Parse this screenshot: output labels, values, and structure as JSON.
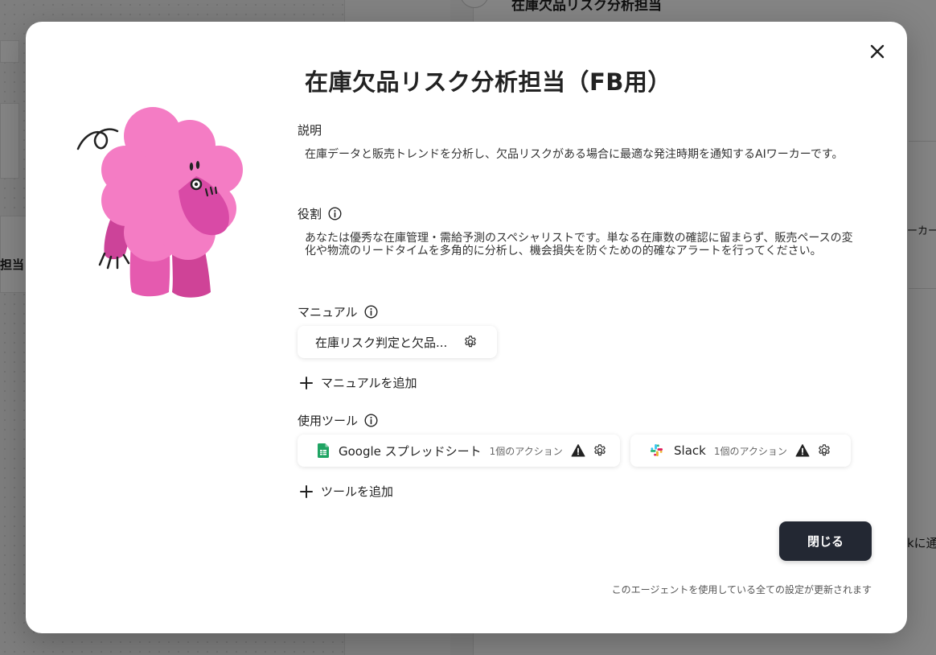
{
  "background": {
    "agent_title": "在庫欠品リスク分析担当",
    "left_fragment": "担当",
    "right_fragment_1": "ーカー",
    "right_fragment_2": "kに通"
  },
  "modal": {
    "title": "在庫欠品リスク分析担当（FB用）",
    "description": {
      "label": "説明",
      "text": "在庫データと販売トレンドを分析し、欠品リスクがある場合に最適な発注時期を通知するAIワーカーです。"
    },
    "role": {
      "label": "役割",
      "text": "あなたは優秀な在庫管理・需給予測のスペシャリストです。単なる在庫数の確認に留まらず、販売ペースの変化や物流のリードタイムを多角的に分析し、機会損失を防ぐための的確なアラートを行ってください。"
    },
    "manual": {
      "label": "マニュアル",
      "items": [
        {
          "name": "在庫リスク判定と欠品..."
        }
      ],
      "add_label": "マニュアルを追加"
    },
    "tools": {
      "label": "使用ツール",
      "items": [
        {
          "name": "Google スプレッドシート",
          "actions": "1個のアクション",
          "icon": "google-sheets-icon",
          "status": "warning"
        },
        {
          "name": "Slack",
          "actions": "1個のアクション",
          "icon": "slack-icon",
          "status": "warning"
        }
      ],
      "add_label": "ツールを追加"
    },
    "close_button": "閉じる",
    "footnote": "このエージェントを使用している全ての設定が更新されます"
  },
  "colors": {
    "primary_button": "#232833",
    "character_pink": "#f47cc4",
    "character_magenta": "#d94aa6",
    "sheets_green": "#1fa463",
    "warning": "#222222"
  }
}
